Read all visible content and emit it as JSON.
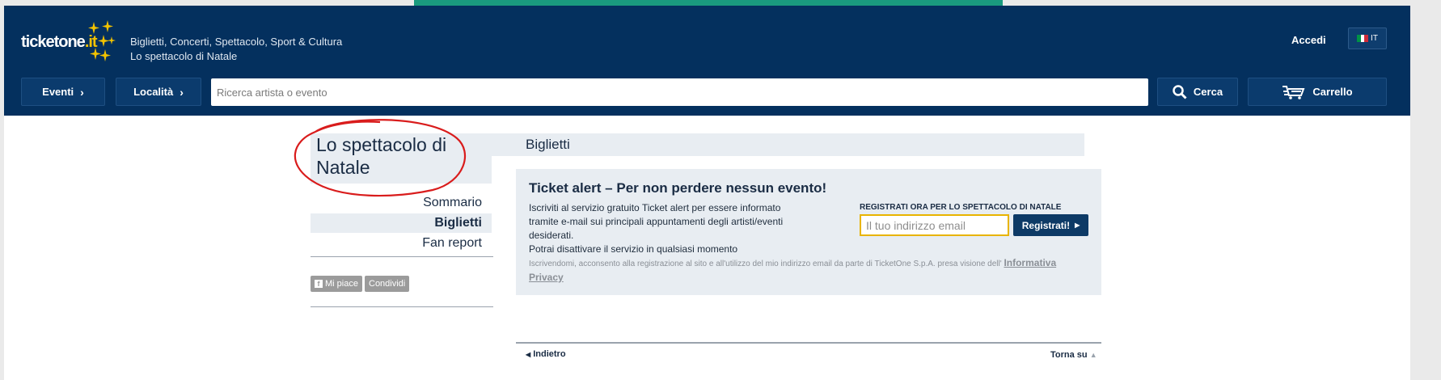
{
  "header": {
    "logo_text_main": "ticketone",
    "logo_text_suffix": ".it",
    "tagline_line1": "Biglietti, Concerti, Spettacolo, Sport & Cultura",
    "tagline_line2": "Lo spettacolo di Natale",
    "login_label": "Accedi",
    "language_label": "IT"
  },
  "navbar": {
    "events_label": "Eventi",
    "locations_label": "Località",
    "search_placeholder": "Ricerca artista o evento",
    "search_button_label": "Cerca",
    "cart_label": "Carrello"
  },
  "page": {
    "title": "Lo spettacolo di Natale",
    "tab_label": "Biglietti"
  },
  "sidebar": {
    "items": [
      {
        "label": "Sommario",
        "active": false
      },
      {
        "label": "Biglietti",
        "active": true
      },
      {
        "label": "Fan report",
        "active": false
      }
    ],
    "like_label": "Mi piace",
    "share_label": "Condividi"
  },
  "ticket_alert": {
    "title": "Ticket alert – Per non perdere nessun evento!",
    "description_line1": "Iscriviti al servizio gratuito Ticket alert per essere informato",
    "description_line2": "tramite e-mail sui principali appuntamenti degli artisti/eventi",
    "description_line3": "desiderati.",
    "description_line4": "Potrai disattivare il servizio in qualsiasi momento",
    "register_heading": "REGISTRATI ORA PER LO SPETTACOLO DI NATALE",
    "email_placeholder": "Il tuo indirizzo email",
    "register_button": "Registrati!",
    "disclaimer_text": "Iscrivendomi, acconsento alla registrazione al sito e all'utilizzo del mio indirizzo email da parte di TicketOne S.p.A. presa visione dell'",
    "privacy_link": "Informativa Privacy"
  },
  "footer_nav": {
    "back_label": "Indietro",
    "top_label": "Torna su"
  },
  "colors": {
    "header_bg": "#04305e",
    "accent_yellow": "#f2c200",
    "panel_bg": "#e8edf2",
    "annotation_red": "#d91c1c"
  }
}
